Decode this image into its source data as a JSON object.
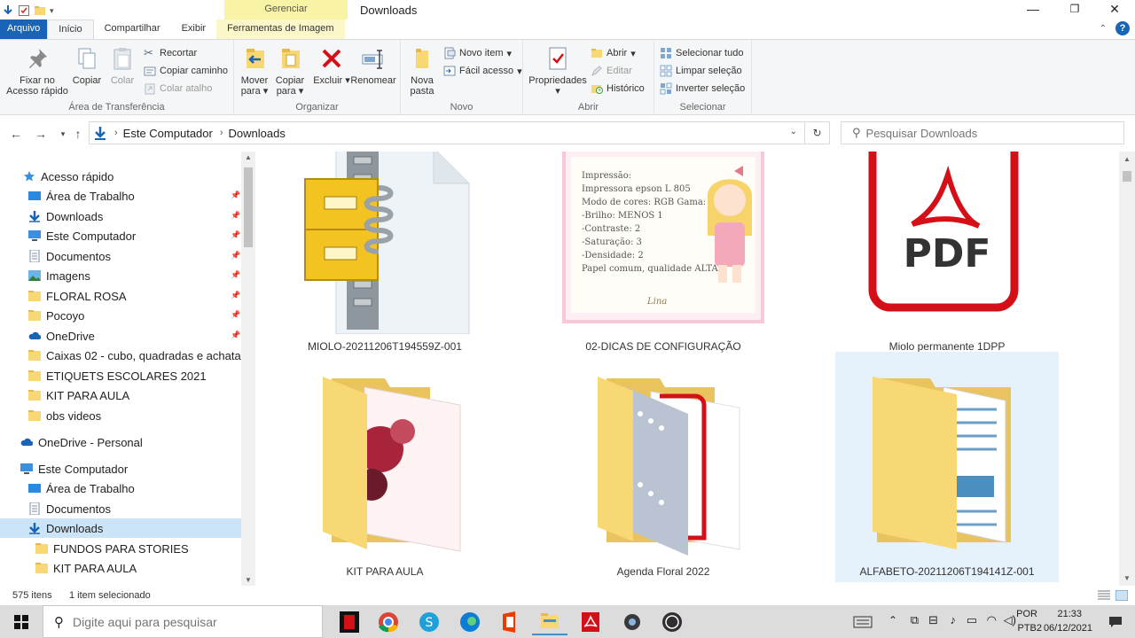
{
  "window": {
    "title": "Downloads",
    "contextual_group": "Gerenciar",
    "minimize": "—",
    "maximize": "❐",
    "close": "✕"
  },
  "tabs": [
    "Arquivo",
    "Início",
    "Compartilhar",
    "Exibir",
    "Ferramentas de Imagem"
  ],
  "ribbon": {
    "clipboard": {
      "label": "Área de Transferência",
      "pin": "Fixar no Acesso rápido",
      "copy": "Copiar",
      "paste": "Colar",
      "cut": "Recortar",
      "copy_path": "Copiar caminho",
      "paste_shortcut": "Colar atalho"
    },
    "organize": {
      "label": "Organizar",
      "move_to": "Mover para",
      "copy_to": "Copiar para",
      "delete": "Excluir",
      "rename": "Renomear"
    },
    "new": {
      "label": "Novo",
      "new_folder": "Nova pasta",
      "new_item": "Novo item",
      "easy_access": "Fácil acesso"
    },
    "open": {
      "label": "Abrir",
      "properties": "Propriedades",
      "open": "Abrir",
      "edit": "Editar",
      "history": "Histórico"
    },
    "select": {
      "label": "Selecionar",
      "select_all": "Selecionar tudo",
      "select_none": "Limpar seleção",
      "invert": "Inverter seleção"
    }
  },
  "address": {
    "crumbs": [
      "Este Computador",
      "Downloads"
    ],
    "search_placeholder": "Pesquisar Downloads"
  },
  "navpane": {
    "quick_access": "Acesso rápido",
    "quick_items": [
      "Área de Trabalho",
      "Downloads",
      "Este Computador",
      "Documentos",
      "Imagens",
      "FLORAL ROSA",
      "Pocoyo",
      "OneDrive",
      "Caixas 02 - cubo, quadradas e achatad",
      "ETIQUETS ESCOLARES 2021",
      "KIT PARA AULA",
      "obs videos"
    ],
    "onedrive_personal": "OneDrive - Personal",
    "this_pc": "Este Computador",
    "pc_items": [
      "Área de Trabalho",
      "Documentos",
      "Downloads"
    ],
    "download_children": [
      "FUNDOS PARA STORIES",
      "KIT PARA AULA"
    ]
  },
  "files": [
    {
      "name": "MIOLO-20211206T194559Z-001"
    },
    {
      "name": "02-DICAS DE CONFIGURAÇÃO",
      "thumb_lines": [
        "Impressão:",
        "Impressora epson L 805",
        "Modo de cores: RGB Gama: 2.2",
        "-Brilho: MENOS 1",
        "-Contraste: 2",
        "-Saturação: 3",
        "-Densidade: 2",
        "Papel comum, qualidade ALTA"
      ],
      "thumb_brand": "Lina"
    },
    {
      "name": "Miolo permanente 1DPP",
      "thumb_text": "PDF"
    },
    {
      "name": "KIT PARA AULA"
    },
    {
      "name": "Agenda Floral 2022"
    },
    {
      "name": "ALFABETO-20211206T194141Z-001"
    }
  ],
  "status": {
    "count": "575 itens",
    "selected": "1 item selecionado"
  },
  "taskbar": {
    "search_placeholder": "Digite aqui para pesquisar",
    "lang1": "POR",
    "lang2": "PTB2",
    "time": "21:33",
    "date": "06/12/2021"
  },
  "colors": {
    "accent": "#1a64b6",
    "selection": "#cce4f7",
    "tile_selection": "#e5f1fb",
    "folder": "#f8d775",
    "pdf_red": "#d40f18"
  }
}
